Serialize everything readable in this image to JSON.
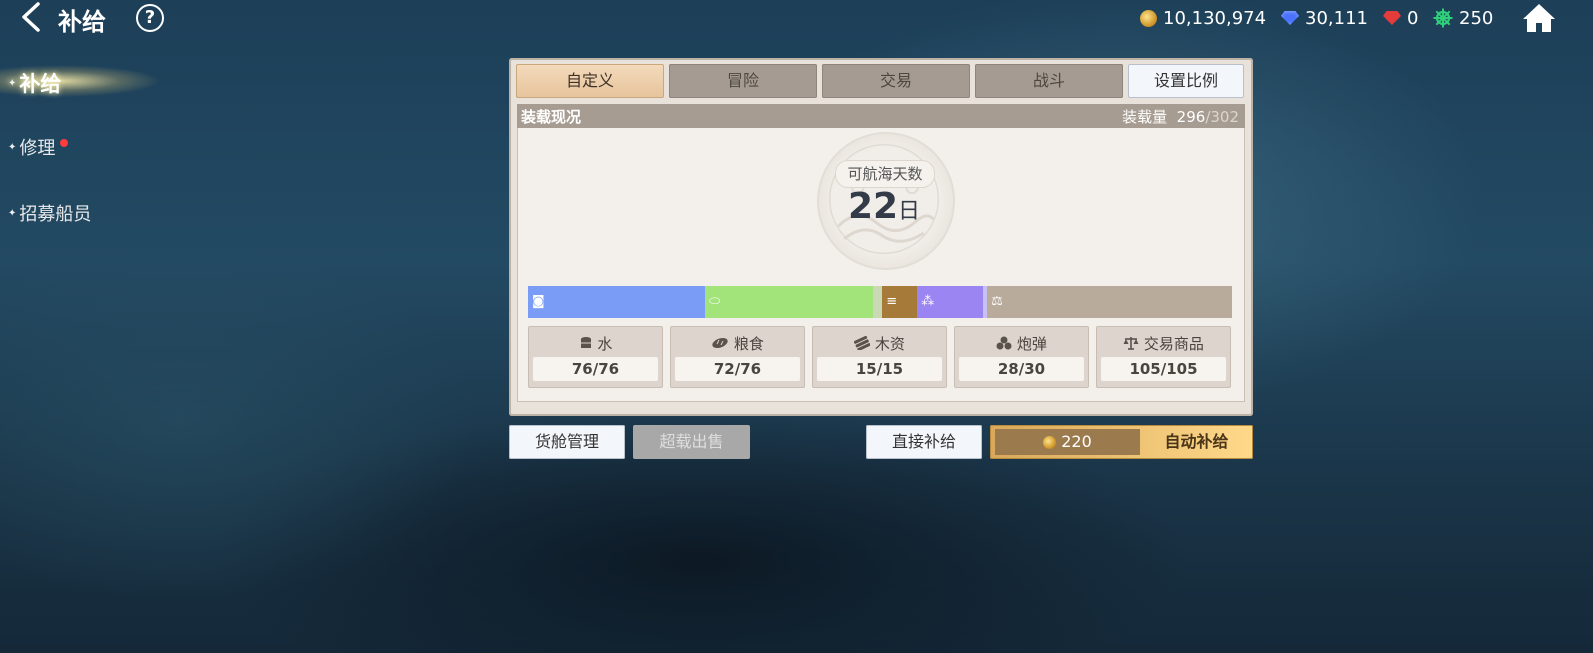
{
  "header": {
    "title": "补给",
    "help": "?",
    "resources": [
      {
        "icon": "gold-coin-icon",
        "value": "10,130,974"
      },
      {
        "icon": "blue-gem-icon",
        "value": "30,111"
      },
      {
        "icon": "red-gem-icon",
        "value": "0"
      },
      {
        "icon": "ship-wheel-icon",
        "value": "250"
      }
    ]
  },
  "sidebar": {
    "items": [
      {
        "label": "补给",
        "active": true
      },
      {
        "label": "修理",
        "badge": true
      },
      {
        "label": "招募船员"
      }
    ]
  },
  "panel": {
    "tabs": [
      "自定义",
      "冒险",
      "交易",
      "战斗"
    ],
    "active_tab": "自定义",
    "ratio_button": "设置比例",
    "load": {
      "title": "装载现况",
      "capacity_label": "装载量",
      "current": "296",
      "max": "/302"
    },
    "days": {
      "label": "可航海天数",
      "value": "22",
      "unit": "日"
    },
    "bar_segments": [
      {
        "name": "water",
        "value": 76,
        "color": "#7a9cf7",
        "icon": "barrel-icon"
      },
      {
        "name": "food",
        "value": 72,
        "color": "#a2e37a",
        "icon": "bread-icon"
      },
      {
        "name": "food-free",
        "value": 4,
        "color": "#c9d9b4",
        "icon": ""
      },
      {
        "name": "lumber",
        "value": 15,
        "color": "#a67b39",
        "icon": "lumber-icon"
      },
      {
        "name": "cannonball",
        "value": 28,
        "color": "#9b85f2",
        "icon": "cannonball-icon"
      },
      {
        "name": "cannonball-free",
        "value": 2,
        "color": "#c8c0f0",
        "icon": ""
      },
      {
        "name": "trade",
        "value": 105,
        "color": "#b9ab9c",
        "icon": "scale-icon"
      }
    ],
    "bar_total": 302,
    "supplies": [
      {
        "icon": "barrel-icon",
        "name": "水",
        "value": "76/76"
      },
      {
        "icon": "bread-icon",
        "name": "粮食",
        "value": "72/76"
      },
      {
        "icon": "lumber-icon",
        "name": "木资",
        "value": "15/15"
      },
      {
        "icon": "cannonball-icon",
        "name": "炮弹",
        "value": "28/30"
      },
      {
        "icon": "scale-icon",
        "name": "交易商品",
        "value": "105/105"
      }
    ]
  },
  "actions": {
    "cargo_manage": "货舱管理",
    "overload_sell": "超载出售",
    "direct_supply": "直接补给",
    "auto_cost": "220",
    "auto_supply": "自动补给"
  }
}
